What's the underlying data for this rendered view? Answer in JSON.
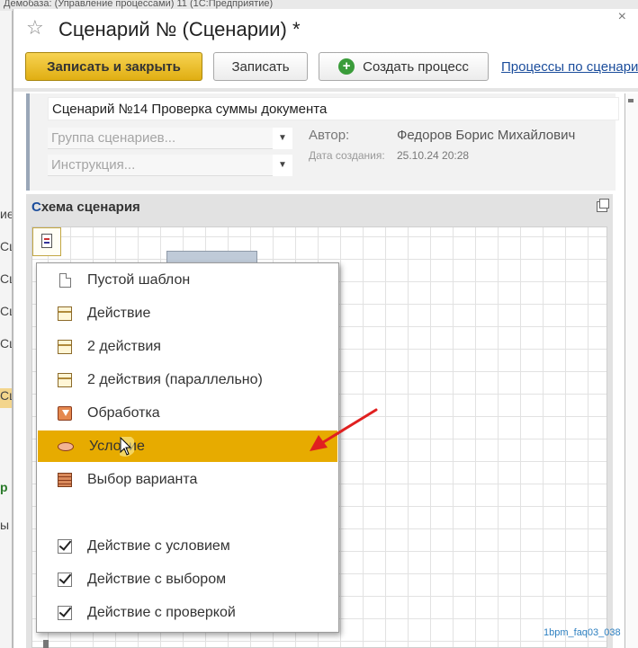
{
  "background": {
    "titlebar_fragment": "Демобаза: (Управление процессами)   11 (1С:Предприятие)",
    "left_fragments": [
      "ие",
      "Сц",
      "Сц",
      "Сц",
      "Сц",
      "Сц",
      "р",
      "ы"
    ]
  },
  "window": {
    "title": "Сценарий № (Сценарии) *",
    "close_glyph": "×"
  },
  "toolbar": {
    "save_close_label": "Записать и закрыть",
    "save_label": "Записать",
    "create_process_label": "Создать процесс",
    "processes_link": "Процессы по сценарию"
  },
  "header": {
    "name_value": "Сценарий №14 Проверка суммы документа",
    "group_placeholder": "Группа сценариев...",
    "instruction_placeholder": "Инструкция...",
    "author_label": "Автор:",
    "author_value": "Федоров Борис Михайлович",
    "created_label": "Дата создания:",
    "created_value": "25.10.24 20:28"
  },
  "schema": {
    "title_first": "С",
    "title_rest": "хема сценария"
  },
  "menu": {
    "items": [
      {
        "label": "Пустой шаблон",
        "icon": "blank-template-icon"
      },
      {
        "label": "Действие",
        "icon": "action-icon"
      },
      {
        "label": "2 действия",
        "icon": "two-actions-icon"
      },
      {
        "label": "2 действия (параллельно)",
        "icon": "two-actions-parallel-icon"
      },
      {
        "label": "Обработка",
        "icon": "processing-icon"
      },
      {
        "label": "Условие",
        "icon": "condition-icon",
        "highlighted": true
      },
      {
        "label": "Выбор варианта",
        "icon": "choice-icon"
      },
      {
        "label": "Действие с условием",
        "icon": "checkbox-checked-icon",
        "checked": true
      },
      {
        "label": "Действие с выбором",
        "icon": "checkbox-checked-icon",
        "checked": true
      },
      {
        "label": "Действие с проверкой",
        "icon": "checkbox-checked-icon",
        "checked": true
      }
    ]
  },
  "footer": {
    "tag": "1bpm_faq03_038"
  },
  "colors": {
    "accent_yellow": "#e7ab00",
    "link_blue": "#1a4c9b",
    "arrow_red": "#e02020"
  }
}
